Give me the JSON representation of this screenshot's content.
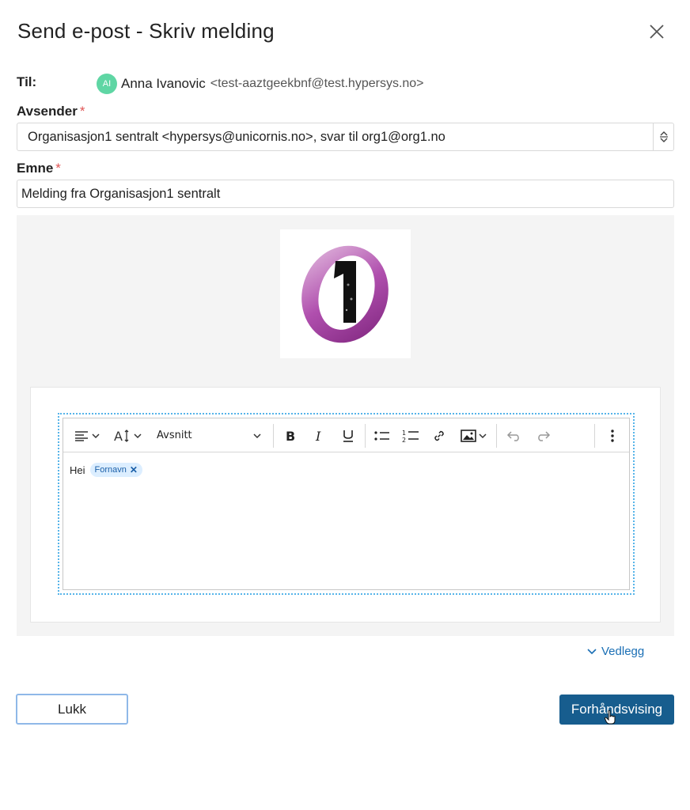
{
  "dialog": {
    "title": "Send e-post - Skriv melding"
  },
  "recipient": {
    "label": "Til:",
    "avatar_initials": "AI",
    "name": "Anna Ivanovic",
    "email": "<test-aaztgeekbnf@test.hypersys.no>"
  },
  "sender": {
    "label": "Avsender",
    "required_mark": "*",
    "value": "Organisasjon1 sentralt <hypersys@unicornis.no>, svar til org1@org1.no"
  },
  "subject": {
    "label": "Emne",
    "required_mark": "*",
    "value": "Melding fra Organisasjon1 sentralt"
  },
  "editor": {
    "format_select": "Avsnitt",
    "toolbar_icons": [
      "align-left-icon",
      "text-size-icon",
      "bold-icon",
      "italic-icon",
      "underline-icon",
      "bullet-list-icon",
      "numbered-list-icon",
      "link-icon",
      "image-icon",
      "undo-icon",
      "redo-icon",
      "more-options-icon"
    ],
    "body_text": "Hei",
    "merge_tag": "Fornavn"
  },
  "attachments": {
    "label": "Vedlegg"
  },
  "footer": {
    "close_label": "Lukk",
    "preview_label": "Forhåndsvising"
  },
  "colors": {
    "primary": "#175d8e",
    "avatar": "#5fd6a4",
    "link": "#1a6fb5",
    "required": "#e05555",
    "logo_purple": "#a0409c"
  }
}
